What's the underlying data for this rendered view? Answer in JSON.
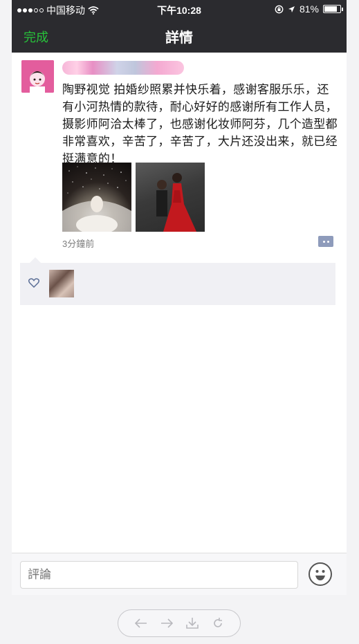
{
  "status_bar": {
    "carrier": "中国移动",
    "time": "下午10:28",
    "battery": "81%",
    "battery_level": 0.81
  },
  "nav": {
    "done_label": "完成",
    "title": "詳情"
  },
  "post": {
    "text": "陶野视觉 拍婚纱照累并快乐着，感谢客服乐乐，还有小河热情的款待，耐心好好的感谢所有工作人员，摄影师阿洽太棒了，也感谢化妆师阿芬，几个造型都非常喜欢，辛苦了，辛苦了，大片还没出来，就已经挺满意的！",
    "time_ago": "3分鐘前"
  },
  "comment": {
    "placeholder": "評論"
  },
  "colors": {
    "accent_green": "#27c23a",
    "nav_bg": "#2b2b2f",
    "link_blue": "#8e9bbb"
  },
  "icons": [
    "wifi-icon",
    "lock-rotation-icon",
    "location-arrow-icon",
    "battery-icon",
    "comment-more-icon",
    "heart-icon",
    "emoji-icon",
    "back-arrow-icon",
    "forward-arrow-icon",
    "download-icon",
    "refresh-icon"
  ]
}
